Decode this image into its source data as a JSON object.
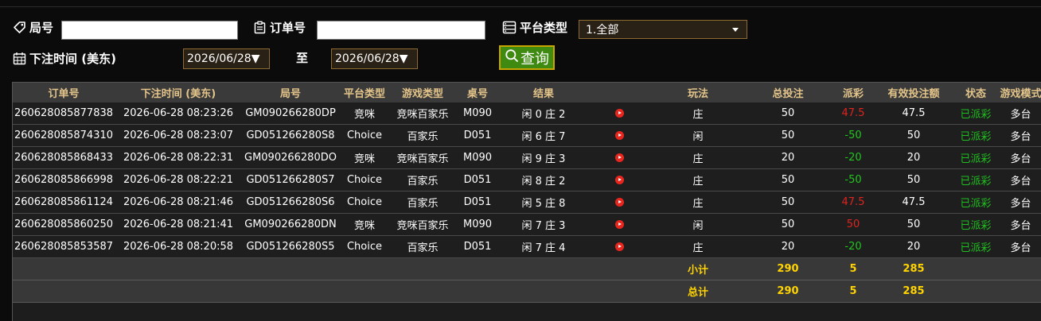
{
  "filters": {
    "round_label": "局号",
    "round_value": "",
    "order_label": "订单号",
    "order_value": "",
    "platform_label": "平台类型",
    "platform_selected": "1.全部",
    "bet_time_label": "下注时间 (美东)",
    "date_from": "2026/06/28▼",
    "to_label": "至",
    "date_to": "2026/06/28▼",
    "query_label": "查询"
  },
  "table": {
    "headers": [
      "订单号",
      "下注时间 (美东)",
      "局号",
      "平台类型",
      "游戏类型",
      "桌号",
      "结果",
      "",
      "玩法",
      "总投注",
      "派彩",
      "有效投注额",
      "状态",
      "游戏模式"
    ],
    "rows": [
      {
        "order": "260628085877838",
        "time": "2026-06-28 08:23:26",
        "round": "GM090266280DP",
        "platform": "竞咪",
        "game": "竞咪百家乐",
        "table": "M090",
        "result": "闲 0 庄 2",
        "play_icon": "play-video-icon",
        "bet": "庄",
        "total": "50",
        "payout": "47.5",
        "payout_type": "neg",
        "valid": "47.5",
        "status": "已派彩",
        "mode": "多台"
      },
      {
        "order": "260628085874310",
        "time": "2026-06-28 08:23:07",
        "round": "GD051266280S8",
        "platform": "Choice",
        "game": "百家乐",
        "table": "D051",
        "result": "闲 6 庄 7",
        "play_icon": "play-video-icon",
        "bet": "闲",
        "total": "50",
        "payout": "-50",
        "payout_type": "pos",
        "valid": "50",
        "status": "已派彩",
        "mode": "多台"
      },
      {
        "order": "260628085868433",
        "time": "2026-06-28 08:22:31",
        "round": "GM090266280DO",
        "platform": "竞咪",
        "game": "竞咪百家乐",
        "table": "M090",
        "result": "闲 9 庄 3",
        "play_icon": "play-video-icon",
        "bet": "庄",
        "total": "20",
        "payout": "-20",
        "payout_type": "pos",
        "valid": "20",
        "status": "已派彩",
        "mode": "多台"
      },
      {
        "order": "260628085866998",
        "time": "2026-06-28 08:22:21",
        "round": "GD051266280S7",
        "platform": "Choice",
        "game": "百家乐",
        "table": "D051",
        "result": "闲 8 庄 2",
        "play_icon": "play-video-icon",
        "bet": "庄",
        "total": "50",
        "payout": "-50",
        "payout_type": "pos",
        "valid": "50",
        "status": "已派彩",
        "mode": "多台"
      },
      {
        "order": "260628085861124",
        "time": "2026-06-28 08:21:46",
        "round": "GD051266280S6",
        "platform": "Choice",
        "game": "百家乐",
        "table": "D051",
        "result": "闲 5 庄 8",
        "play_icon": "play-video-icon",
        "bet": "庄",
        "total": "50",
        "payout": "47.5",
        "payout_type": "neg",
        "valid": "47.5",
        "status": "已派彩",
        "mode": "多台"
      },
      {
        "order": "260628085860250",
        "time": "2026-06-28 08:21:41",
        "round": "GM090266280DN",
        "platform": "竞咪",
        "game": "竞咪百家乐",
        "table": "M090",
        "result": "闲 7 庄 3",
        "play_icon": "play-video-icon",
        "bet": "闲",
        "total": "50",
        "payout": "50",
        "payout_type": "neg",
        "valid": "50",
        "status": "已派彩",
        "mode": "多台"
      },
      {
        "order": "260628085853587",
        "time": "2026-06-28 08:20:58",
        "round": "GD051266280S5",
        "platform": "Choice",
        "game": "百家乐",
        "table": "D051",
        "result": "闲 7 庄 4",
        "play_icon": "play-video-icon",
        "bet": "庄",
        "total": "20",
        "payout": "-20",
        "payout_type": "pos",
        "valid": "20",
        "status": "已派彩",
        "mode": "多台"
      }
    ],
    "subtotal": {
      "label": "小计",
      "total": "290",
      "payout": "5",
      "valid": "285"
    },
    "grandtotal": {
      "label": "总计",
      "total": "290",
      "payout": "5",
      "valid": "285"
    }
  },
  "colors": {
    "header_text": "#e3c48a",
    "positive_green": "#22c51f",
    "negative_red": "#e0241f",
    "summary_yellow": "#ffd400",
    "query_button": "#3f8a10"
  }
}
